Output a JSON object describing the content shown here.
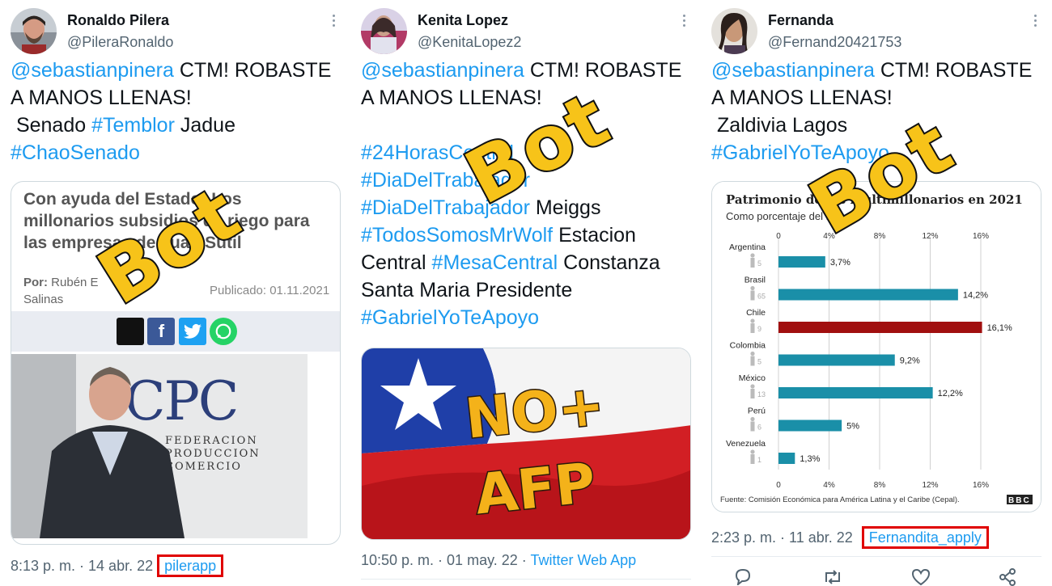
{
  "tweets": [
    {
      "name": "Ronaldo Pilera",
      "handle": "@PileraRonaldo",
      "text_mention": "@sebastianpinera",
      "text_1": " CTM! ROBASTE\nA MANOS LLENAS!\n Senado ",
      "tag_1": "#Temblor",
      "text_2": " Jadue\n",
      "tag_2": "#ChaoSenado",
      "card": {
        "headline": "Con ayuda del Estado: Los millonarios subsidios de riego para las empresas de Juan Sutil",
        "byline_label": "Por:",
        "byline_name": "Rubén E",
        "byline_name_2": "Salinas",
        "published": "Publicado: 01.11.2021",
        "photo_logo": "CPC",
        "photo_text_1": "FEDERACION",
        "photo_text_2": "PRODUCCION",
        "photo_text_3": "COMERCIO"
      },
      "time": "8:13 p. m. · 14 abr. 22",
      "source": "pilerapp",
      "stamp": "Bot"
    },
    {
      "name": "Kenita Lopez",
      "handle": "@KenitaLopez2",
      "text_mention": "@sebastianpinera",
      "text_1": " CTM! ROBASTE\nA MANOS LLENAS!\n\n",
      "tag_1": "#24HorasCentral",
      "tag_2": "#DiaDelTrabajador",
      "tag_3": "#DiaDelTrabajador",
      "text_2": " Meiggs",
      "tag_4": "#TodosSomosMrWolf",
      "text_3": " Estacion\nCentral ",
      "tag_5": "#MesaCentral",
      "text_4": " Constanza\nSanta Maria Presidente\n",
      "tag_6": "#GabrielYoTeApoyo",
      "image_line_1": "NO+",
      "image_line_2": "AFP",
      "time": "10:50 p. m. · 01 may. 22 · ",
      "source": "Twitter Web App",
      "stamp": "Bot"
    },
    {
      "name": "Fernanda",
      "handle": "@Fernand20421753",
      "text_mention": "@sebastianpinera",
      "text_1": " CTM! ROBASTE\nA MANOS LLENAS!\n Zaldivia Lagos\n",
      "tag_1": "#GabrielYoTeApoyo",
      "time": "2:23 p. m. · 11 abr. 22",
      "source": "Fernandita_apply",
      "stamp": "Bot"
    }
  ],
  "chart_data": {
    "type": "bar",
    "title": "Patrimonio de los multimillonarios en 2021",
    "subtitle": "Como porcentaje del PIB",
    "categories": [
      "Argentina",
      "Brasil",
      "Chile",
      "Colombia",
      "México",
      "Perú",
      "Venezuela"
    ],
    "counts": [
      "5",
      "65",
      "9",
      "5",
      "13",
      "6",
      "1"
    ],
    "values": [
      3.7,
      14.2,
      16.1,
      9.2,
      12.2,
      5,
      1.3
    ],
    "value_labels": [
      "3,7%",
      "14,2%",
      "16,1%",
      "9,2%",
      "12,2%",
      "5%",
      "1,3%"
    ],
    "xticks": [
      "0",
      "4%",
      "8%",
      "12%",
      "16%"
    ],
    "xlim": [
      0,
      16
    ],
    "colors": {
      "default": "#1a8fa8",
      "highlight": "#a10f0f"
    },
    "highlight": "Chile",
    "source": "Fuente: Comisión Económica para América Latina y el Caribe (Cepal).",
    "brand": "BBC"
  }
}
